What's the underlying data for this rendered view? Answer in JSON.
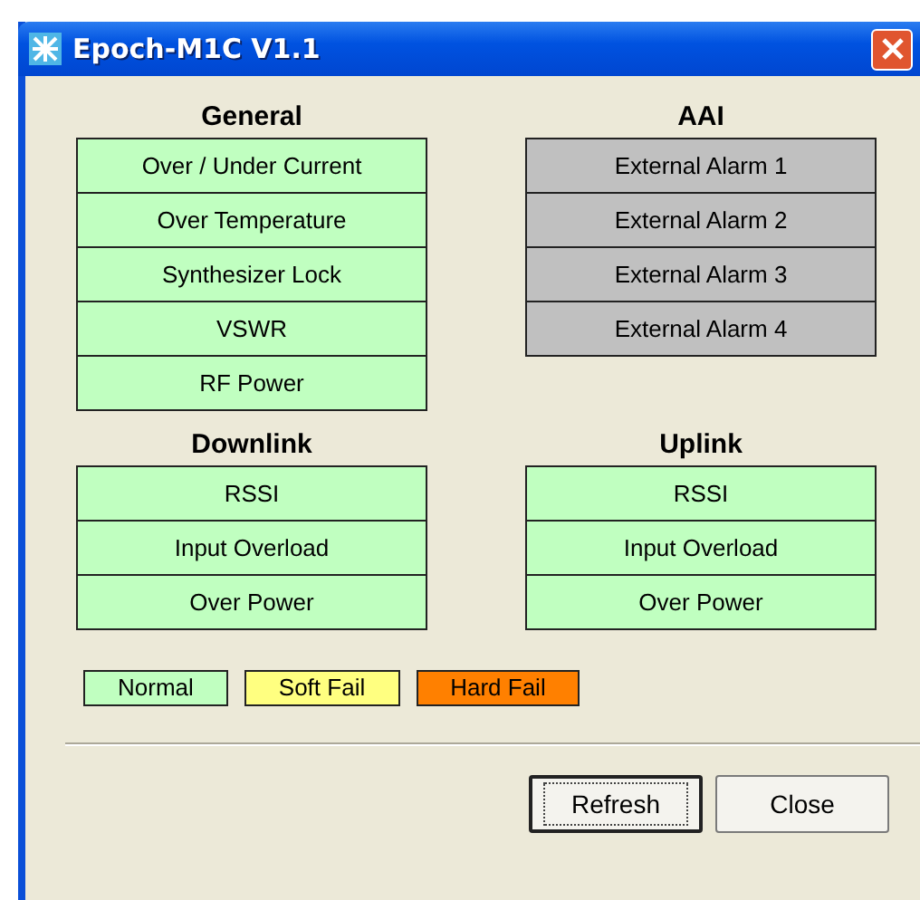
{
  "window": {
    "title": "Epoch-M1C V1.1"
  },
  "groups": [
    {
      "title": "General",
      "items": [
        {
          "label": "Over / Under Current",
          "kind": "normal"
        },
        {
          "label": "Over Temperature",
          "kind": "normal"
        },
        {
          "label": "Synthesizer Lock",
          "kind": "normal"
        },
        {
          "label": "VSWR",
          "kind": "normal"
        },
        {
          "label": "RF Power",
          "kind": "normal"
        }
      ]
    },
    {
      "title": "AAI",
      "items": [
        {
          "label": "External Alarm 1",
          "kind": "inactive"
        },
        {
          "label": "External Alarm 2",
          "kind": "inactive"
        },
        {
          "label": "External Alarm 3",
          "kind": "inactive"
        },
        {
          "label": "External Alarm 4",
          "kind": "inactive"
        }
      ]
    },
    {
      "title": "Downlink",
      "items": [
        {
          "label": "RSSI",
          "kind": "normal"
        },
        {
          "label": "Input Overload",
          "kind": "normal"
        },
        {
          "label": "Over Power",
          "kind": "normal"
        }
      ]
    },
    {
      "title": "Uplink",
      "items": [
        {
          "label": "RSSI",
          "kind": "normal"
        },
        {
          "label": "Input Overload",
          "kind": "normal"
        },
        {
          "label": "Over Power",
          "kind": "normal"
        }
      ]
    }
  ],
  "legend": [
    {
      "label": "Normal",
      "kind": "normal"
    },
    {
      "label": "Soft Fail",
      "kind": "soft"
    },
    {
      "label": "Hard Fail",
      "kind": "hard"
    }
  ],
  "buttons": [
    {
      "label": "Refresh",
      "selected": true
    },
    {
      "label": "Close",
      "selected": false
    }
  ]
}
